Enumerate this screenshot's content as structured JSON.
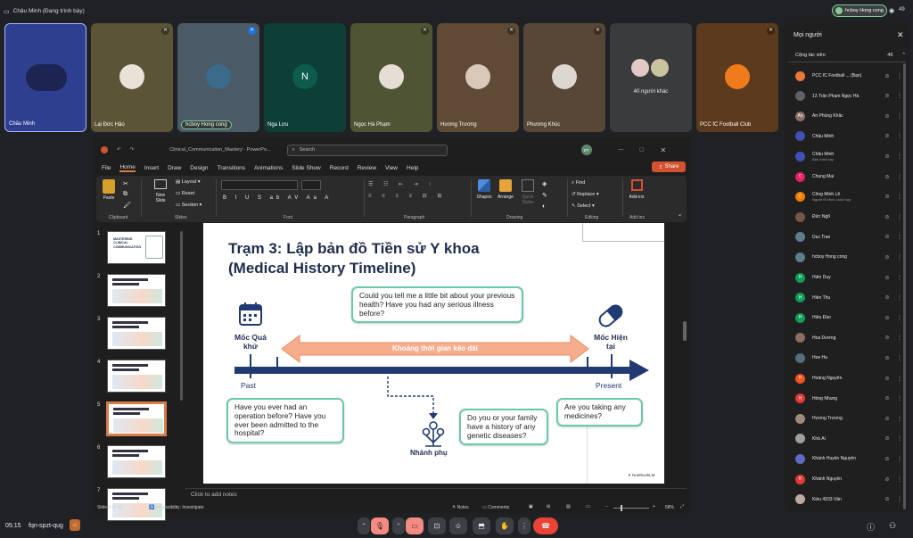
{
  "top": {
    "presenter_label": "Châu Minh (Đang trình bày)",
    "self_pill": "hcboy Hong cong",
    "participant_count": "49"
  },
  "tiles": [
    {
      "name": "Châu Minh"
    },
    {
      "name": "Lại Đức Hảo"
    },
    {
      "name": "hcboy Hong cong"
    },
    {
      "name": "Nga Lưu",
      "initial": "N"
    },
    {
      "name": "Ngọc Hà Phạm"
    },
    {
      "name": "Hương Trương"
    },
    {
      "name": "Phương Khúc"
    },
    {
      "name": "40 người khác"
    },
    {
      "name": "PCC fC Football Club"
    }
  ],
  "people": {
    "title": "Mọi người",
    "section": "Cộng tác viên",
    "section_count": "49",
    "list": [
      {
        "name": "PCC fC Football ... (Bạn)",
        "initial": "",
        "color": "#e8793b"
      },
      {
        "name": "13 Trần Phạm Ngọc Hà",
        "initial": "",
        "color": "#5f6368"
      },
      {
        "name": "An Phùng Khắc",
        "initial": "An",
        "color": "#8d6e63"
      },
      {
        "name": "Châu Minh",
        "initial": "",
        "color": "#3f51b5"
      },
      {
        "name": "Châu Minh",
        "sub": "Bản trình bày",
        "initial": "",
        "color": "#3f51b5"
      },
      {
        "name": "Chung Mai",
        "initial": "C",
        "color": "#e91e63"
      },
      {
        "name": "Công Minh Lê",
        "sub": "Người tổ chức cuộc họp",
        "initial": "C",
        "color": "#f57c00"
      },
      {
        "name": "Đức Ngô",
        "initial": "",
        "color": "#795548"
      },
      {
        "name": "Duc Tran",
        "initial": "",
        "color": "#607d8b"
      },
      {
        "name": "hcboy Hong cong",
        "initial": "",
        "color": "#607d8b"
      },
      {
        "name": "Hiền Duy",
        "initial": "H",
        "color": "#0f9d58"
      },
      {
        "name": "Hiền Thu",
        "initial": "H",
        "color": "#0f9d58"
      },
      {
        "name": "Hiếu Đào",
        "initial": "H",
        "color": "#0f9d58"
      },
      {
        "name": "Hoa Dương",
        "initial": "",
        "color": "#8d6e63"
      },
      {
        "name": "Hoe Ha",
        "initial": "",
        "color": "#546e7a"
      },
      {
        "name": "Hoàng Nguyễn",
        "initial": "H",
        "color": "#f4511e"
      },
      {
        "name": "Hồng Nhung",
        "initial": "H",
        "color": "#e53935"
      },
      {
        "name": "Hương Trương",
        "initial": "",
        "color": "#a1887f"
      },
      {
        "name": "Khả Ái",
        "initial": "",
        "color": "#9e9e9e"
      },
      {
        "name": "Khánh Huyền Nguyễn",
        "initial": "",
        "color": "#5c6bc0"
      },
      {
        "name": "Khánh Nguyễn",
        "initial": "K",
        "color": "#e53935"
      },
      {
        "name": "Kiều 4933 Văn",
        "initial": "",
        "color": "#bcaaa4"
      }
    ]
  },
  "ppt": {
    "doc_title": "Clinical_Communication_Mastery · PowerPo...",
    "search_placeholder": "Search",
    "user_initials": "DT",
    "menu": [
      "File",
      "Home",
      "Insert",
      "Draw",
      "Design",
      "Transitions",
      "Animations",
      "Slide Show",
      "Record",
      "Review",
      "View",
      "Help"
    ],
    "share": "Share",
    "ribbon": {
      "paste": "Paste",
      "new_slide": "New Slide",
      "layout": "Layout",
      "reset": "Reset",
      "section": "Section",
      "clipboard": "Clipboard",
      "slides": "Slides",
      "font": "Font",
      "paragraph": "Paragraph",
      "shapes": "Shapes",
      "arrange": "Arrange",
      "quick_styles": "Quick Styles",
      "drawing": "Drawing",
      "find": "Find",
      "replace": "Replace",
      "select": "Select",
      "editing": "Editing",
      "addins": "Add-ins",
      "addins_group": "Add-ins"
    },
    "thumb_numbers": [
      "1",
      "2",
      "3",
      "4",
      "5",
      "6",
      "7"
    ],
    "thumb1_title": "MASTERING CLINICAL COMMUNICATION",
    "notes_placeholder": "Click to add notes",
    "status": {
      "slide": "Slide 5 of 10",
      "accessibility": "Accessibility: Investigate",
      "notes": "Notes",
      "comments": "Comments",
      "zoom": "58%"
    }
  },
  "slide": {
    "title_line1": "Trạm 3: Lập bản đồ Tiền sử Y khoa",
    "title_line2": "(Medical History Timeline)",
    "past_label": "Mốc Quá khứ",
    "present_label": "Mốc Hiện tại",
    "range_label": "Khoảng thời gian kéo dài",
    "past": "Past",
    "present": "Present",
    "branch_label": "Nhánh phụ",
    "q1": "Could you tell me a little bit about your previous health? Have you had any serious illness before?",
    "q2": "Have you ever had an operation before? Have you ever been admitted to the hospital?",
    "q3": "Do you or your family have a history of any genetic diseases?",
    "q4": "Are you taking any medicines?",
    "watermark": "NotebookLM"
  },
  "bottom": {
    "time": "05:15",
    "meeting_code": "fqn-spzt-qug"
  }
}
